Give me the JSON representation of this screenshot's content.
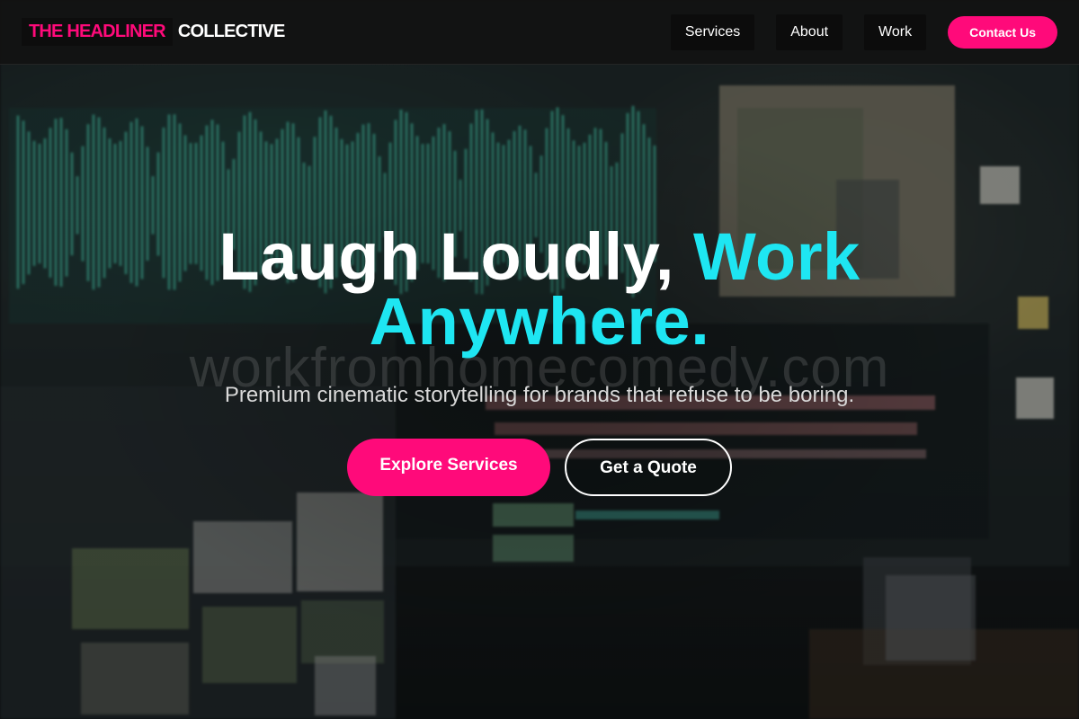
{
  "brand": {
    "name_highlight": "THE HEADLINER",
    "name_rest": "COLLECTIVE"
  },
  "nav": {
    "links": [
      "Services",
      "About",
      "Work"
    ],
    "contact_label": "Contact Us"
  },
  "hero": {
    "title_line1": "Laugh Loudly,",
    "title_accent_1": "Work",
    "title_accent_2": "Anywhere.",
    "watermark": "workfromhomecomedy.com",
    "subtitle": "Premium cinematic storytelling for brands that refuse to be boring.",
    "primary_cta": "Explore Services",
    "secondary_cta": "Get a Quote"
  },
  "colors": {
    "accent_pink": "#ff0a7a",
    "accent_cyan": "#1ee6f2",
    "nav_bg": "#121212"
  },
  "background": {
    "depicts": "video-editing-monitor-photo"
  }
}
